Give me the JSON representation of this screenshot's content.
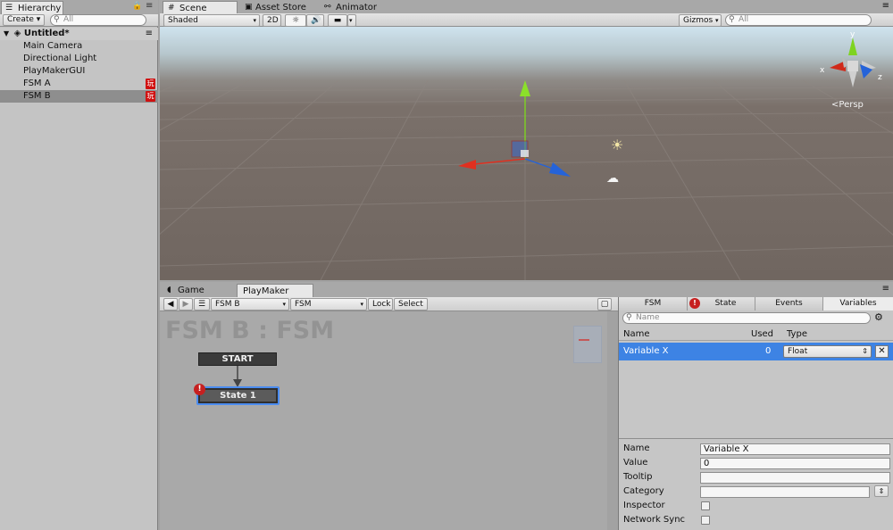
{
  "hierarchy": {
    "tab_label": "Hierarchy",
    "create_label": "Create",
    "search_placeholder": "All",
    "scene_name": "Untitled*",
    "items": [
      {
        "label": "Main Camera"
      },
      {
        "label": "Directional Light"
      },
      {
        "label": "PlayMakerGUI"
      },
      {
        "label": "FSM A",
        "badge": "玩"
      },
      {
        "label": "FSM B",
        "badge": "玩",
        "selected": true
      }
    ]
  },
  "top_tabs": [
    "Scene",
    "Asset Store",
    "Animator"
  ],
  "scene_toolbar": {
    "shading": "Shaded",
    "mode_2d": "2D",
    "gizmos_label": "Gizmos",
    "search_placeholder": "All"
  },
  "scene_view": {
    "gizmo_x": "x",
    "gizmo_y": "y",
    "gizmo_z": "z",
    "projection": "Persp"
  },
  "bottom_tabs": [
    "Game",
    "PlayMaker"
  ],
  "playmaker": {
    "fsm_select": "FSM B",
    "fsm_name_select": "FSM",
    "lock_label": "Lock",
    "select_label": "Select",
    "graph_title": "FSM B : FSM",
    "start_label": "START",
    "state_label": "State 1",
    "panel_tabs": [
      "FSM",
      "State",
      "Events",
      "Variables"
    ],
    "var_search_placeholder": "Name",
    "table_headers": {
      "name": "Name",
      "used": "Used",
      "type": "Type"
    },
    "variables": [
      {
        "name": "Variable X",
        "used": "0",
        "type": "Float"
      }
    ],
    "props": {
      "name_label": "Name",
      "name_value": "Variable X",
      "value_label": "Value",
      "value_value": "0",
      "tooltip_label": "Tooltip",
      "tooltip_value": "",
      "category_label": "Category",
      "category_value": "",
      "inspector_label": "Inspector",
      "network_label": "Network Sync"
    }
  },
  "colors": {
    "selection_blue": "#3d83e4",
    "badge_red": "#d01010",
    "axis_red": "#e03020",
    "axis_green": "#7ed321",
    "axis_blue": "#2563d9"
  }
}
